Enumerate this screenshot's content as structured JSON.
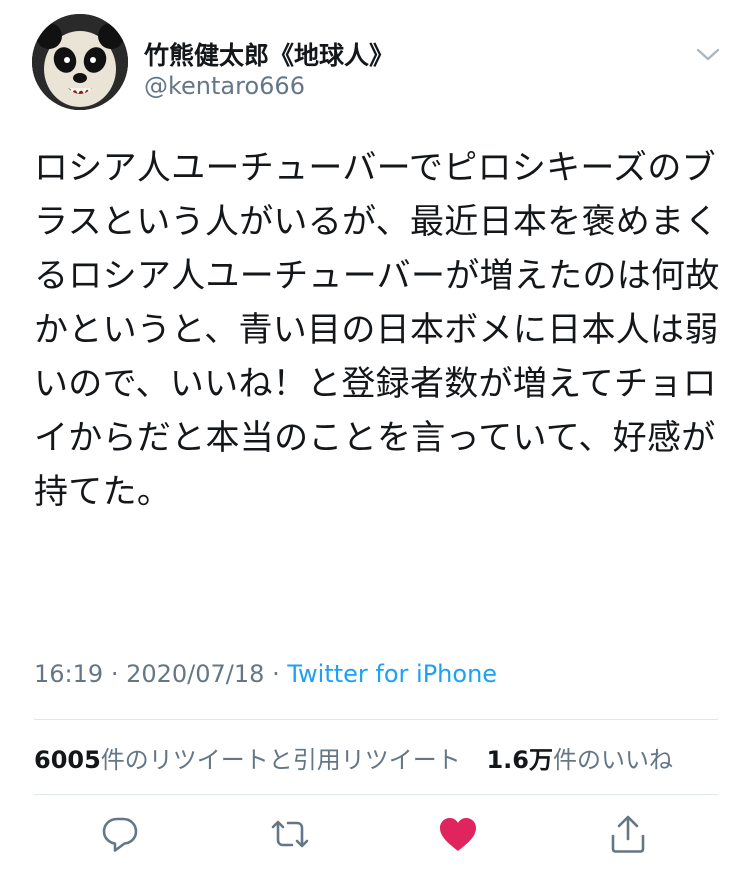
{
  "user": {
    "display_name": "竹熊健太郎《地球人》",
    "handle": "@kentaro666",
    "avatar_icon": "panda-avatar"
  },
  "tweet": {
    "text": "ロシア人ユーチューバーでピロシキーズのブラスという人がいるが、最近日本を褒めまくるロシア人ユーチューバーが増えたのは何故かというと、青い目の日本ボメに日本人は弱いので、いいね！と登録者数が増えてチョロイからだと本当のことを言っていて、好感が持てた。",
    "time": "16:19",
    "date": "2020/07/18",
    "separator": "·",
    "source": "Twitter for iPhone"
  },
  "stats": {
    "retweets_count": "6005",
    "retweets_label": "件のリツイートと引用リツイート",
    "likes_count": "1.6万",
    "likes_label": "件のいいね"
  },
  "actions": {
    "reply_icon": "reply-icon",
    "retweet_icon": "retweet-icon",
    "like_icon": "heart-icon",
    "share_icon": "share-icon"
  },
  "colors": {
    "text": "#14171a",
    "secondary": "#657786",
    "link": "#1da1f2",
    "like": "#e0245e",
    "divider": "#e1e8ed"
  }
}
